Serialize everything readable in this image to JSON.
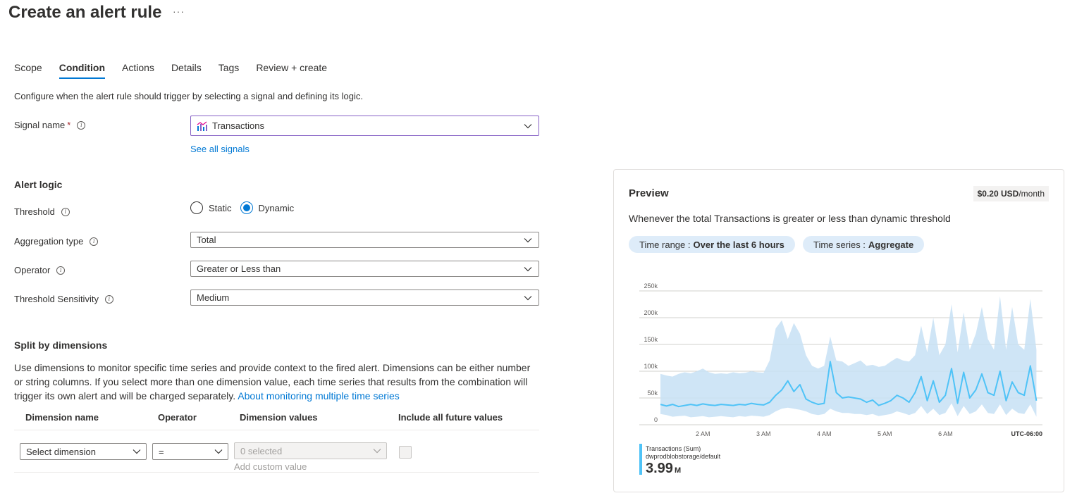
{
  "header": {
    "title": "Create an alert rule",
    "more": "···"
  },
  "tabs": [
    {
      "label": "Scope"
    },
    {
      "label": "Condition"
    },
    {
      "label": "Actions"
    },
    {
      "label": "Details"
    },
    {
      "label": "Tags"
    },
    {
      "label": "Review + create"
    }
  ],
  "intro": "Configure when the alert rule should trigger by selecting a signal and defining its logic.",
  "signal": {
    "label": "Signal name",
    "required_mark": "*",
    "value": "Transactions",
    "see_all": "See all signals"
  },
  "alert_logic": {
    "title": "Alert logic",
    "threshold_label": "Threshold",
    "threshold_options": [
      "Static",
      "Dynamic"
    ],
    "threshold_selected": "Dynamic",
    "aggregation_label": "Aggregation type",
    "aggregation_value": "Total",
    "operator_label": "Operator",
    "operator_value": "Greater or Less than",
    "sensitivity_label": "Threshold Sensitivity",
    "sensitivity_value": "Medium"
  },
  "split": {
    "title": "Split by dimensions",
    "description": "Use dimensions to monitor specific time series and provide context to the fired alert. Dimensions can be either number or string columns. If you select more than one dimension value, each time series that results from the combination will trigger its own alert and will be charged separately.",
    "link": "About monitoring multiple time series",
    "columns": [
      "Dimension name",
      "Operator",
      "Dimension values",
      "Include all future values"
    ],
    "row": {
      "dimension": "Select dimension",
      "operator": "=",
      "values": "0 selected",
      "custom": "Add custom value"
    }
  },
  "preview": {
    "title": "Preview",
    "price_amount": "$0.20 USD",
    "price_unit": "/month",
    "description": "Whenever the total Transactions is greater or less than dynamic threshold",
    "time_range_label": "Time range :",
    "time_range_value": "Over the last 6 hours",
    "time_series_label": "Time series :",
    "time_series_value": "Aggregate",
    "legend_name": "Transactions (Sum)",
    "legend_sub": "dwprodblobstorage/default",
    "legend_value": "3.99",
    "legend_unit": "M"
  },
  "colors": {
    "accent": "#0078d4",
    "series": "#4fc3f7",
    "band": "#c7e0f4"
  },
  "chart_data": {
    "type": "area",
    "title": "",
    "y_ticks": [
      "0",
      "50k",
      "100k",
      "150k",
      "200k",
      "250k"
    ],
    "ylim": [
      0,
      250000
    ],
    "x_ticks": [
      "2 AM",
      "3 AM",
      "4 AM",
      "5 AM",
      "6 AM"
    ],
    "x_tick_hours": [
      2,
      3,
      4,
      5,
      6
    ],
    "x_range_hours": [
      1.3,
      7.6
    ],
    "timezone_label": "UTC-06:00",
    "series": [
      {
        "name": "Transactions (Sum)",
        "x": [
          1.3,
          1.4,
          1.5,
          1.6,
          1.7,
          1.8,
          1.9,
          2.0,
          2.1,
          2.2,
          2.3,
          2.4,
          2.5,
          2.6,
          2.7,
          2.8,
          2.9,
          3.0,
          3.1,
          3.2,
          3.3,
          3.4,
          3.5,
          3.6,
          3.7,
          3.8,
          3.9,
          4.0,
          4.1,
          4.2,
          4.3,
          4.4,
          4.5,
          4.6,
          4.7,
          4.8,
          4.9,
          5.0,
          5.1,
          5.2,
          5.3,
          5.4,
          5.5,
          5.6,
          5.7,
          5.8,
          5.9,
          6.0,
          6.1,
          6.2,
          6.3,
          6.4,
          6.5,
          6.6,
          6.7,
          6.8,
          6.9,
          7.0,
          7.1,
          7.2,
          7.3,
          7.4,
          7.5
        ],
        "values": [
          38000,
          35000,
          38000,
          34000,
          36000,
          38000,
          36000,
          39000,
          37000,
          36000,
          38000,
          37000,
          36000,
          38000,
          37000,
          40000,
          38000,
          37000,
          42000,
          55000,
          65000,
          82000,
          62000,
          75000,
          48000,
          42000,
          38000,
          40000,
          118000,
          60000,
          50000,
          52000,
          50000,
          48000,
          42000,
          46000,
          36000,
          40000,
          45000,
          55000,
          50000,
          42000,
          60000,
          90000,
          45000,
          82000,
          42000,
          55000,
          105000,
          40000,
          98000,
          50000,
          65000,
          95000,
          60000,
          55000,
          100000,
          45000,
          80000,
          60000,
          55000,
          110000,
          45000
        ],
        "band_upper": [
          95000,
          92000,
          90000,
          95000,
          98000,
          96000,
          100000,
          105000,
          98000,
          95000,
          96000,
          95000,
          98000,
          96000,
          97000,
          100000,
          98000,
          97000,
          120000,
          180000,
          195000,
          160000,
          190000,
          170000,
          130000,
          110000,
          105000,
          110000,
          165000,
          120000,
          118000,
          110000,
          115000,
          120000,
          110000,
          112000,
          108000,
          110000,
          118000,
          125000,
          120000,
          118000,
          130000,
          185000,
          135000,
          200000,
          130000,
          150000,
          225000,
          135000,
          210000,
          140000,
          170000,
          220000,
          160000,
          140000,
          240000,
          140000,
          220000,
          150000,
          140000,
          235000,
          140000
        ],
        "band_lower": [
          20000,
          18000,
          15000,
          16000,
          17000,
          14000,
          15000,
          16000,
          14000,
          15000,
          16000,
          15000,
          14000,
          16000,
          15000,
          17000,
          16000,
          15000,
          18000,
          25000,
          30000,
          32000,
          30000,
          28000,
          25000,
          20000,
          18000,
          20000,
          30000,
          25000,
          22000,
          22000,
          20000,
          20000,
          18000,
          20000,
          16000,
          18000,
          20000,
          25000,
          22000,
          18000,
          22000,
          35000,
          20000,
          30000,
          18000,
          22000,
          40000,
          16000,
          35000,
          20000,
          25000,
          38000,
          22000,
          20000,
          38000,
          18000,
          30000,
          22000,
          20000,
          38000,
          15000
        ]
      }
    ]
  }
}
